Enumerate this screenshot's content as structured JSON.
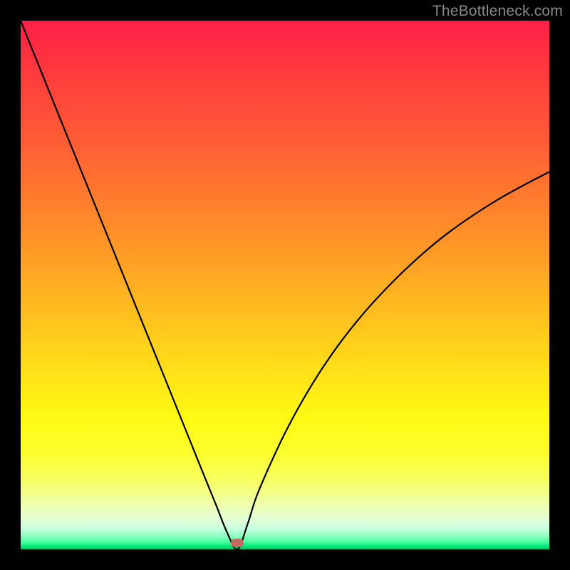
{
  "watermark": "TheBottleneck.com",
  "chart_data": {
    "type": "line",
    "title": "",
    "xlabel": "",
    "ylabel": "",
    "xlim": [
      0,
      100
    ],
    "ylim": [
      0,
      100
    ],
    "x": [
      0,
      5,
      10,
      15,
      20,
      25,
      30,
      35,
      37,
      39,
      41,
      43,
      45,
      50,
      55,
      60,
      65,
      70,
      75,
      80,
      85,
      90,
      95,
      100
    ],
    "values": [
      100,
      87.6,
      75.2,
      62.8,
      50.4,
      38.0,
      25.6,
      13.2,
      8.3,
      3.3,
      0.0,
      5.0,
      11.0,
      22.0,
      31.0,
      38.5,
      44.8,
      50.2,
      55.0,
      59.2,
      62.8,
      66.0,
      68.8,
      71.4
    ],
    "marker": {
      "x": 41,
      "y": 1.2
    },
    "gradient_stops": [
      {
        "pos": 0.0,
        "color": "#ff1f47"
      },
      {
        "pos": 0.5,
        "color": "#ffbd1f"
      },
      {
        "pos": 0.8,
        "color": "#fbff30"
      },
      {
        "pos": 0.97,
        "color": "#8dffc0"
      },
      {
        "pos": 1.0,
        "color": "#00c765"
      }
    ]
  }
}
